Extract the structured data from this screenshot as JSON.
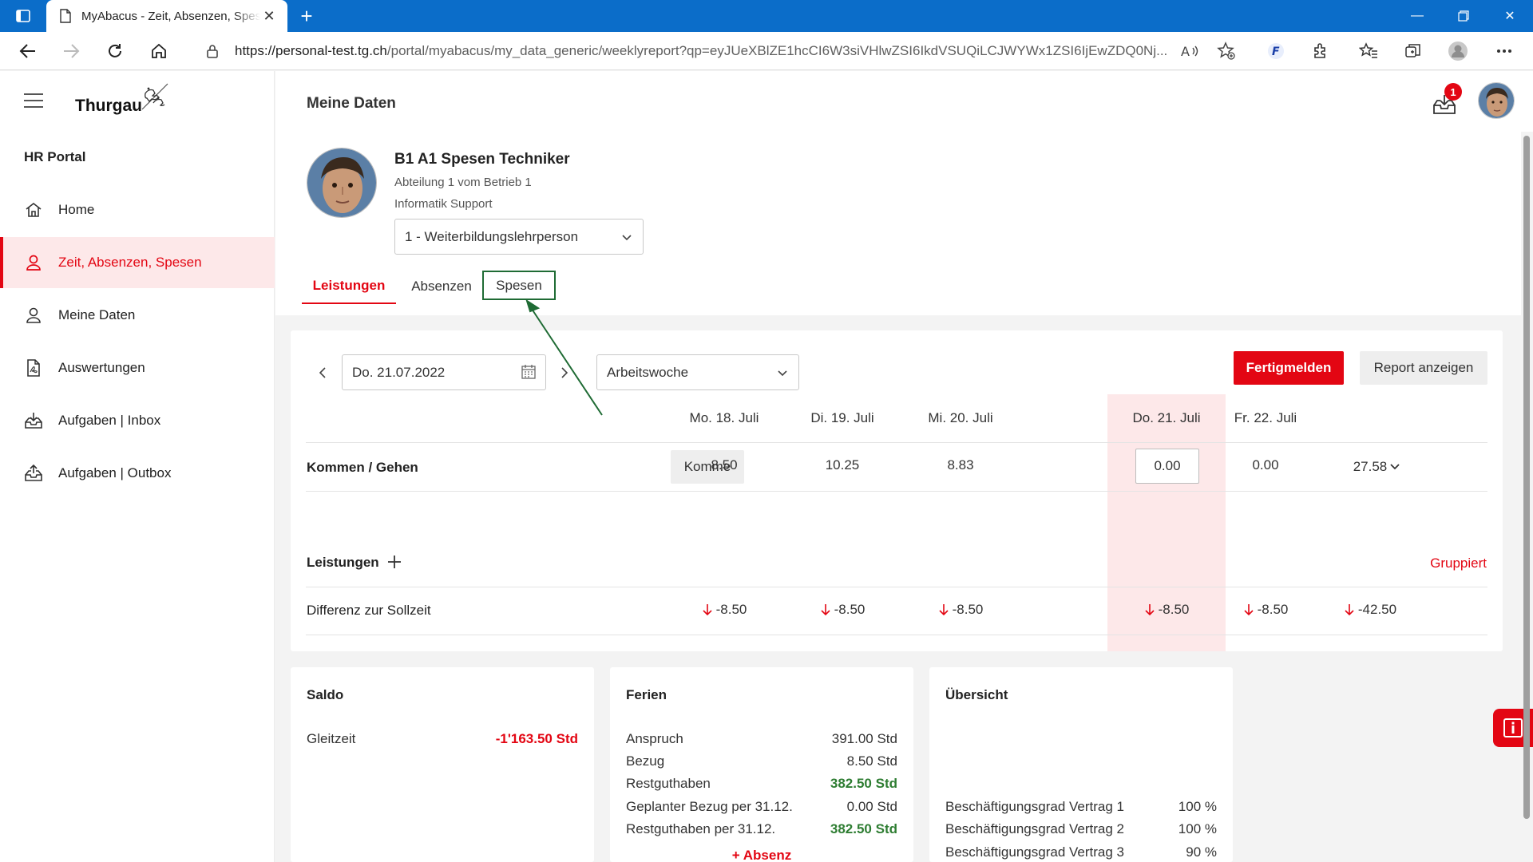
{
  "browser": {
    "tab_title": "MyAbacus - Zeit, Absenzen, Spesen",
    "url_host": "https://personal-test.tg.ch",
    "url_path": "/portal/myabacus/my_data_generic/weeklyreport?qp=eyJUeXBlZE1hcCI6W3siVHlwZSI6IkdVSUQiLCJWYWx1ZSI6IjEwZDQ0Nj..."
  },
  "sidebar": {
    "logo": "Thurgau",
    "section": "HR Portal",
    "items": [
      {
        "label": "Home",
        "icon": "home-icon"
      },
      {
        "label": "Zeit, Absenzen, Spesen",
        "icon": "person-icon"
      },
      {
        "label": "Meine Daten",
        "icon": "person-icon"
      },
      {
        "label": "Auswertungen",
        "icon": "pdf-icon"
      },
      {
        "label": "Aufgaben | Inbox",
        "icon": "inbox-icon"
      },
      {
        "label": "Aufgaben | Outbox",
        "icon": "outbox-icon"
      }
    ]
  },
  "header": {
    "title": "Meine Daten",
    "notification_count": "1"
  },
  "profile": {
    "name": "B1 A1 Spesen Techniker",
    "department": "Abteilung 1 vom Betrieb 1",
    "unit": "Informatik Support",
    "contract_selected": "1 - Weiterbildungslehrperson"
  },
  "tabs": [
    {
      "label": "Leistungen"
    },
    {
      "label": "Absenzen"
    },
    {
      "label": "Spesen"
    }
  ],
  "weekly": {
    "date_value": "Do. 21.07.2022",
    "period_selected": "Arbeitswoche",
    "submit_label": "Fertigmelden",
    "report_label": "Report anzeigen",
    "days": [
      "Mo. 18. Juli",
      "Di. 19. Juli",
      "Mi. 20. Juli",
      "Do. 21. Juli",
      "Fr. 22. Juli"
    ],
    "kommen_gehen": {
      "label": "Kommen / Gehen",
      "chip": "Komme",
      "values": [
        "8.50",
        "10.25",
        "8.83",
        "0.00",
        "0.00"
      ],
      "total": "27.58"
    },
    "leistungen_label": "Leistungen",
    "gruppiert_label": "Gruppiert",
    "differenz": {
      "label": "Differenz zur Sollzeit",
      "values": [
        "-8.50",
        "-8.50",
        "-8.50",
        "-8.50",
        "-8.50"
      ],
      "total": "-42.50"
    }
  },
  "saldo": {
    "title": "Saldo",
    "gleitzeit_label": "Gleitzeit",
    "gleitzeit_value": "-1'163.50 Std"
  },
  "ferien": {
    "title": "Ferien",
    "rows": [
      {
        "label": "Anspruch",
        "value": "391.00 Std"
      },
      {
        "label": "Bezug",
        "value": "8.50 Std"
      },
      {
        "label": "Restguthaben",
        "value": "382.50 Std"
      },
      {
        "label": "Geplanter Bezug per 31.12.",
        "value": "0.00 Std"
      },
      {
        "label": "Restguthaben per 31.12.",
        "value": "382.50 Std"
      }
    ],
    "add_label": "+ Absenz"
  },
  "uebersicht": {
    "title": "Übersicht",
    "rows": [
      {
        "label": "Beschäftigungsgrad Vertrag 1",
        "value": "100 %"
      },
      {
        "label": "Beschäftigungsgrad Vertrag 2",
        "value": "100 %"
      },
      {
        "label": "Beschäftigungsgrad Vertrag 3",
        "value": "90 %"
      }
    ]
  },
  "colors": {
    "accent": "#e30613",
    "positive": "#2e7d32",
    "browser_blue": "#0b6dc9",
    "annotation": "#1f6b34"
  }
}
